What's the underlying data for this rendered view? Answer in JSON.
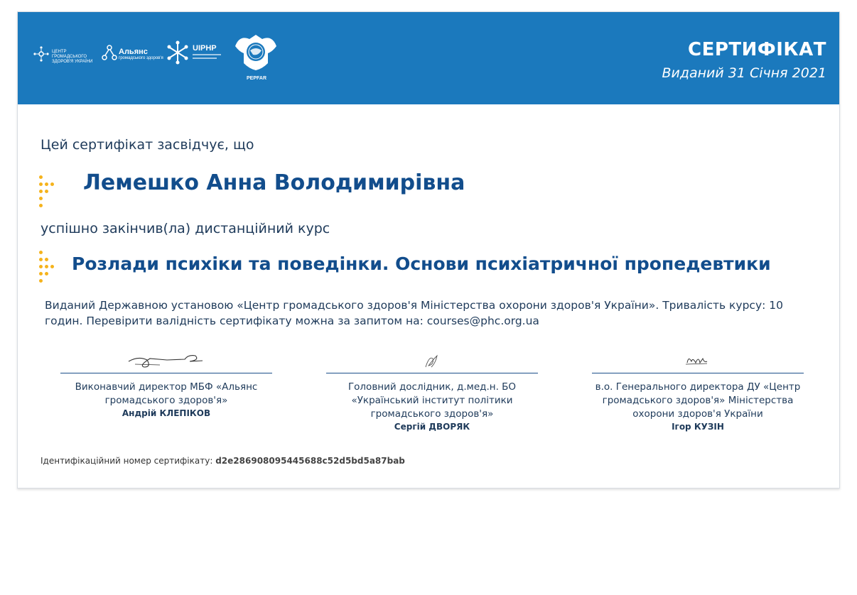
{
  "header": {
    "title": "СЕРТИФІКАТ",
    "issue_date": "Виданий 31 Січня 2021",
    "logos": {
      "phc": "ЦЕНТР ГРОМАДСЬКОГО ЗДОРОВ'Я УКРАЇНИ",
      "alliance": "Альянс",
      "alliance_sub": "громадського здоров'я",
      "uiphp": "UIPHP",
      "pepfar": "PEPFAR"
    }
  },
  "body": {
    "intro": "Цей сертифікат засвідчує, що",
    "recipient_name": "Лемешко Анна Володимирівна",
    "completed_text": "успішно закінчив(ла) дистанційний курс",
    "course_name": "Розлади психіки та поведінки. Основи психіатричної пропедевтики",
    "issued_by_text": "Виданий Державною установою «Центр громадського здоров'я Міністерства охорони здоров'я України». Тривалість курсу: 10 годин. Перевірити валідність сертифікату можна за запитом на: courses@phc.org.ua"
  },
  "signatures": [
    {
      "role": "Виконавчий директор МБФ «Альянс громадського здоров'я»",
      "name": "Андрій КЛЕПІКОВ"
    },
    {
      "role": "Головний дослідник, д.мед.н. БО «Український інститут політики громадського здоров'я»",
      "name": "Сергій ДВОРЯК"
    },
    {
      "role": "в.о. Генерального директора ДУ «Центр громадського здоров'я» Міністерства охорони здоров'я України",
      "name": "Ігор КУЗІН"
    }
  ],
  "footer": {
    "id_label": "Ідентифікаційний номер сертифікату:",
    "id_value": "d2e286908095445688c52d5bd5a87bab"
  },
  "colors": {
    "banner": "#1b79bd",
    "accent_dots": "#f5b31c",
    "heading_blue": "#124d8c"
  }
}
